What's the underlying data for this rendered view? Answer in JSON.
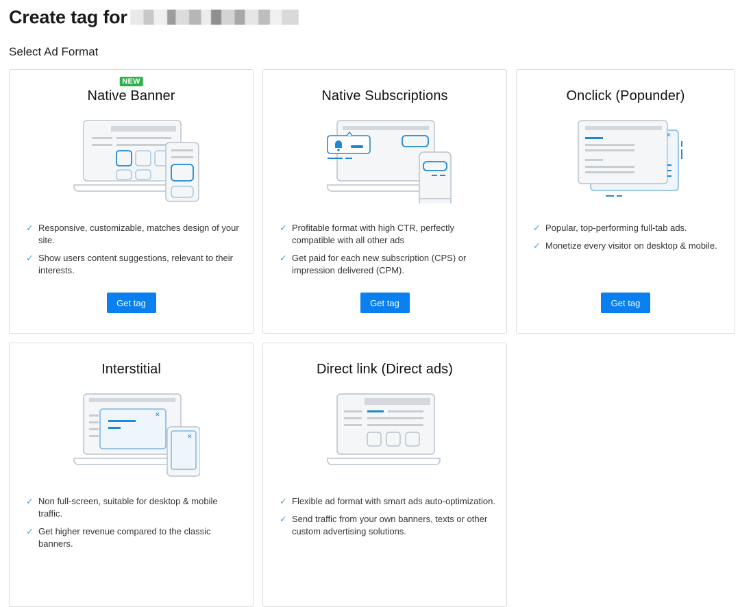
{
  "header": {
    "title": "Create tag for",
    "section_label": "Select Ad Format"
  },
  "colors": {
    "accent": "#0a7ff0",
    "badge": "#2bb34b",
    "check": "#4a9fd8",
    "illustration_blue": "#1e88d6"
  },
  "cards": [
    {
      "badge": "NEW",
      "title": "Native Banner",
      "illustration": "native-banner-illustration",
      "features": [
        "Responsive, customizable, matches design of your site.",
        "Show users content suggestions, relevant to their interests."
      ],
      "button": "Get tag"
    },
    {
      "title": "Native Subscriptions",
      "illustration": "native-subscriptions-illustration",
      "features": [
        "Profitable format with high CTR, perfectly compatible with all other ads",
        "Get paid for each new subscription (CPS) or impression delivered (CPM)."
      ],
      "button": "Get tag"
    },
    {
      "title": "Onclick (Popunder)",
      "illustration": "popunder-illustration",
      "features": [
        "Popular, top-performing full-tab ads.",
        "Monetize every visitor on desktop & mobile."
      ],
      "button": "Get tag"
    },
    {
      "title": "Interstitial",
      "illustration": "interstitial-illustration",
      "features": [
        "Non full-screen, suitable for desktop & mobile traffic.",
        "Get higher revenue compared to the classic banners."
      ]
    },
    {
      "title": "Direct link (Direct ads)",
      "illustration": "direct-link-illustration",
      "features": [
        "Flexible ad format with smart ads auto-optimization.",
        "Send traffic from your own banners, texts or other custom advertising solutions."
      ]
    }
  ]
}
